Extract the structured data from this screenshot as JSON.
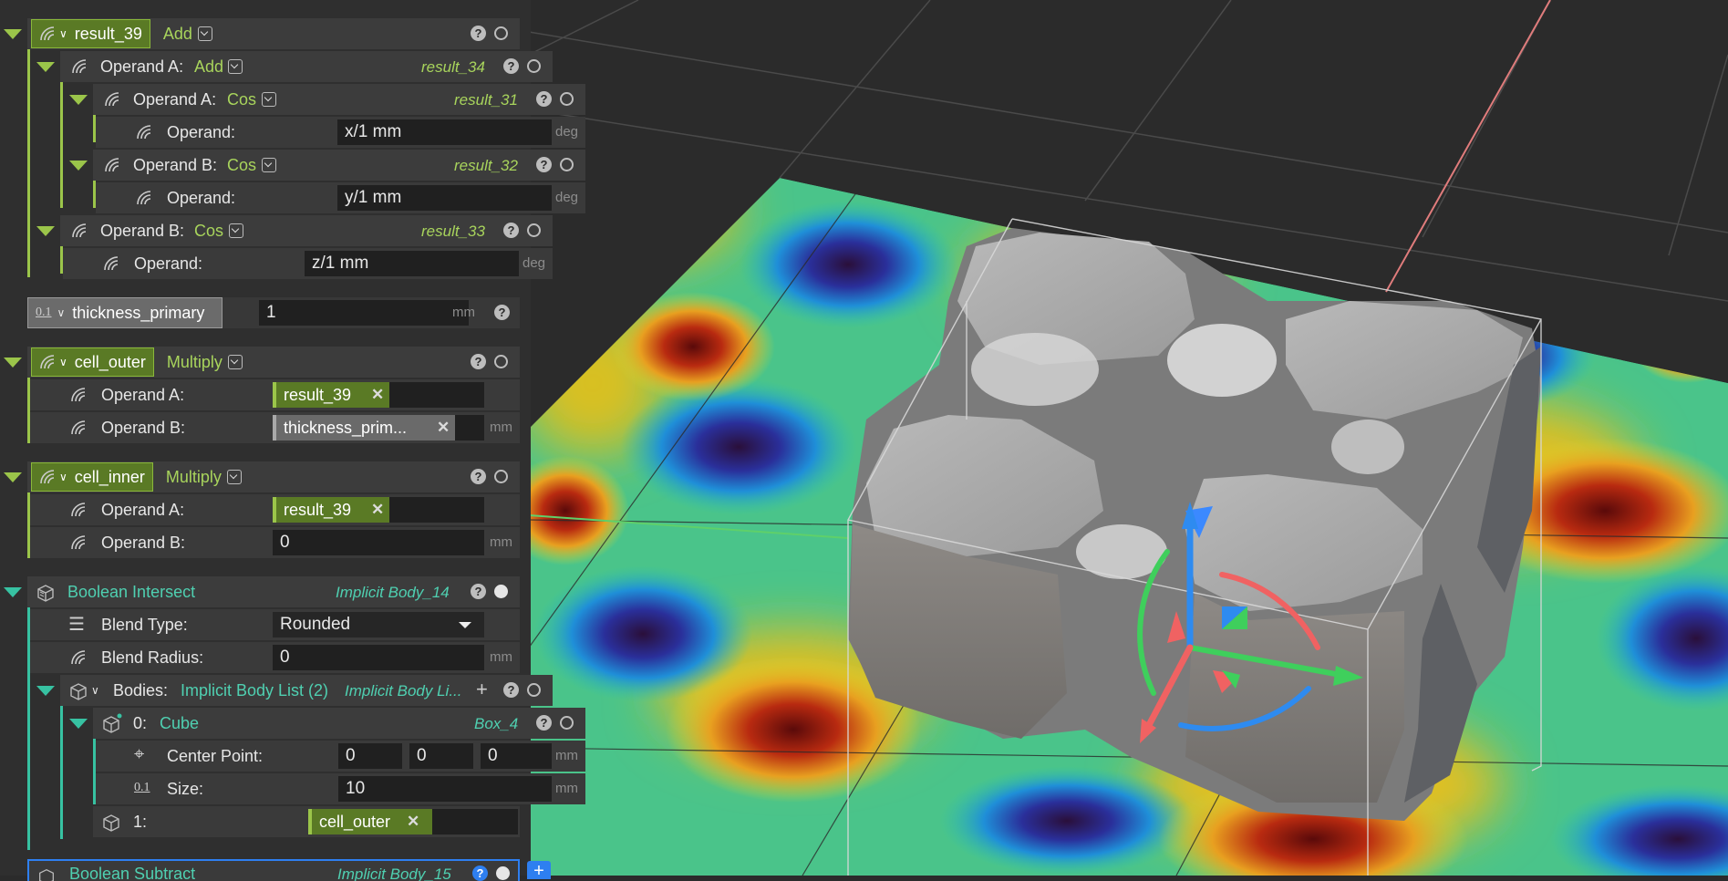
{
  "colors": {
    "accent_green": "#9bc54a",
    "accent_teal": "#37c2a2",
    "panel_bg": "#3a3a3a",
    "selection_blue": "#2e7ff0"
  },
  "nodes": {
    "result_39": {
      "name": "result_39",
      "op": "Add"
    },
    "operand_a_34": {
      "label": "Operand A:",
      "op": "Add",
      "ref": "result_34"
    },
    "operand_a_31": {
      "label": "Operand A:",
      "op": "Cos",
      "ref": "result_31",
      "operand_label": "Operand:",
      "operand_value": "x/1 mm",
      "unit": "deg"
    },
    "operand_b_32": {
      "label": "Operand B:",
      "op": "Cos",
      "ref": "result_32",
      "operand_label": "Operand:",
      "operand_value": "y/1 mm",
      "unit": "deg"
    },
    "operand_b_33": {
      "label": "Operand B:",
      "op": "Cos",
      "ref": "result_33",
      "operand_label": "Operand:",
      "operand_value": "z/1 mm",
      "unit": "deg"
    },
    "thickness": {
      "type_label": "0.1",
      "name": "thickness_primary",
      "value": "1",
      "unit": "mm"
    },
    "cell_outer": {
      "name": "cell_outer",
      "op": "Multiply",
      "operand_a_label": "Operand A:",
      "operand_a_chip": "result_39",
      "operand_b_label": "Operand B:",
      "operand_b_chip": "thickness_prim...",
      "unit": "mm"
    },
    "cell_inner": {
      "name": "cell_inner",
      "op": "Multiply",
      "operand_a_label": "Operand A:",
      "operand_a_chip": "result_39",
      "operand_b_label": "Operand B:",
      "operand_b_value": "0",
      "unit": "mm"
    },
    "boolean": {
      "title": "Boolean Intersect",
      "ref": "Implicit Body_14",
      "blend_type_label": "Blend Type:",
      "blend_type_value": "Rounded",
      "blend_radius_label": "Blend Radius:",
      "blend_radius_value": "0",
      "unit": "mm"
    },
    "bodies": {
      "label": "Bodies:",
      "op": "Implicit Body List (2)",
      "ref": "Implicit Body Li..."
    },
    "body0": {
      "index": "0:",
      "op": "Cube",
      "ref": "Box_4",
      "center_label": "Center Point:",
      "cx": "0",
      "cy": "0",
      "cz": "0",
      "size_label": "Size:",
      "size_value": "10",
      "unit": "mm",
      "size_icon": "0.1"
    },
    "body1": {
      "index": "1:",
      "chip": "cell_outer"
    },
    "boolean_subtract": {
      "title": "Boolean Subtract",
      "ref": "Implicit Body_15"
    }
  },
  "icons": [
    "wave-icon",
    "chevron-down-icon",
    "help-icon",
    "circle-icon",
    "cube-icon",
    "list-icon",
    "crosshair-icon",
    "plus-icon",
    "close-icon"
  ]
}
